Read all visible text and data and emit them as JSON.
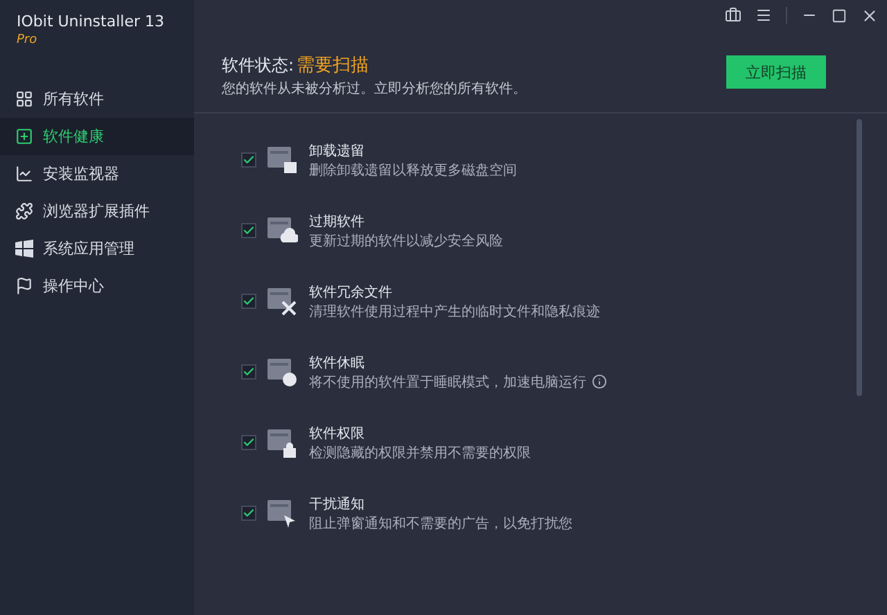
{
  "app": {
    "title": "IObit Uninstaller 13",
    "edition": "Pro"
  },
  "sidebar": {
    "items": [
      {
        "label": "所有软件",
        "selected": false
      },
      {
        "label": "软件健康",
        "selected": true
      },
      {
        "label": "安装监视器",
        "selected": false
      },
      {
        "label": "浏览器扩展插件",
        "selected": false
      },
      {
        "label": "系统应用管理",
        "selected": false
      },
      {
        "label": "操作中心",
        "selected": false
      }
    ]
  },
  "status": {
    "label": "软件状态:",
    "value": "需要扫描",
    "description": "您的软件从未被分析过。立即分析您的所有软件。"
  },
  "scan_button": "立即扫描",
  "items": [
    {
      "title": "卸载遗留",
      "description": "删除卸载遗留以释放更多磁盘空间",
      "checked": true,
      "info": false
    },
    {
      "title": "过期软件",
      "description": "更新过期的软件以减少安全风险",
      "checked": true,
      "info": false
    },
    {
      "title": "软件冗余文件",
      "description": "清理软件使用过程中产生的临时文件和隐私痕迹",
      "checked": true,
      "info": false
    },
    {
      "title": "软件休眠",
      "description": "将不使用的软件置于睡眠模式，加速电脑运行",
      "checked": true,
      "info": true
    },
    {
      "title": "软件权限",
      "description": "检测隐藏的权限并禁用不需要的权限",
      "checked": true,
      "info": false
    },
    {
      "title": "干扰通知",
      "description": "阻止弹窗通知和不需要的广告，以免打扰您",
      "checked": true,
      "info": false
    }
  ]
}
